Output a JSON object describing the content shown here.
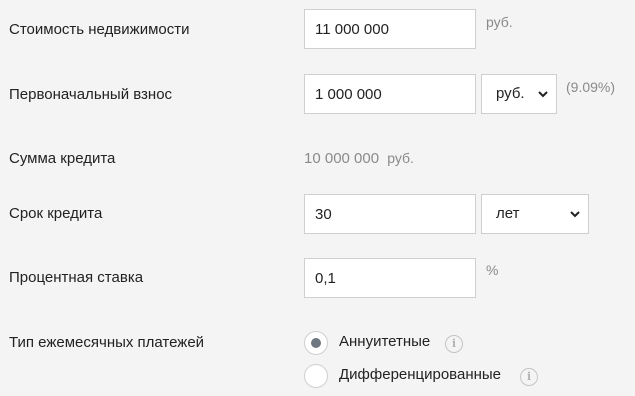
{
  "property_cost": {
    "label": "Стоимость недвижимости",
    "value": "11 000 000",
    "unit": "руб."
  },
  "down_payment": {
    "label": "Первоначальный взнос",
    "value": "1 000 000",
    "currency_selected": "руб.",
    "percent": "(9.09%)"
  },
  "loan_amount": {
    "label": "Сумма кредита",
    "value": "10 000 000",
    "unit": "руб."
  },
  "loan_term": {
    "label": "Срок кредита",
    "value": "30",
    "unit_selected": "лет"
  },
  "interest_rate": {
    "label": "Процентная ставка",
    "value": "0,1",
    "unit": "%"
  },
  "payment_type": {
    "label": "Тип ежемесячных платежей",
    "options": [
      {
        "label": "Аннуитетные",
        "checked": true,
        "info_icon": "info-icon"
      },
      {
        "label": "Дифференцированные",
        "checked": false,
        "info_icon": "info-icon"
      }
    ]
  },
  "colors": {
    "background": "#f4f4f4",
    "muted_text": "#8a8a8a",
    "border": "#cfcfcf",
    "radio_dot": "#6e7680"
  }
}
